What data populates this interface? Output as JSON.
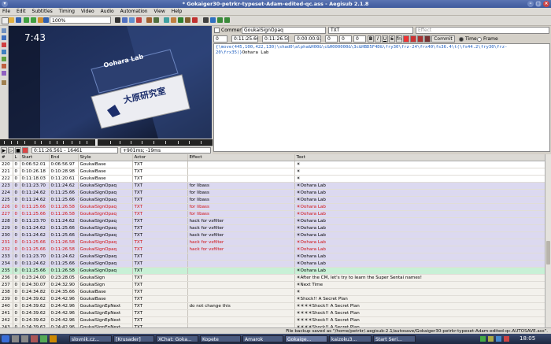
{
  "window": {
    "title": "* Gokaiger30-petrkr-typeset-Adam-edited-qc.ass - Aegisub 2.1.8"
  },
  "menu": [
    "File",
    "Edit",
    "Subtitles",
    "Timing",
    "Video",
    "Audio",
    "Automation",
    "View",
    "Help"
  ],
  "toolbar": {
    "zoom": "100%"
  },
  "video": {
    "clock": "7:43",
    "sign_en": "Oohara Lab",
    "sign_jp": "大原研究室"
  },
  "video_controls": {
    "position": "0:11:26.561 - 16461",
    "offset": "+901ms; -19ms"
  },
  "edit": {
    "comment_label": "Comment",
    "style": "GoukaiSignOpaq",
    "actor": "TXT",
    "effect_placeholder": "Effect",
    "layer": "0",
    "start": "0:11:25.66",
    "end": "0:11:26.58",
    "duration": "0:00:00.92",
    "margin_l": "0",
    "margin_r": "0",
    "margin_v": "0",
    "commit": "Commit",
    "time_label": "Time",
    "frame_label": "Frame",
    "text_tags": "{\\move(445,100,422,130)\\shad0\\alpha&H00&\\c&H000000&\\3c&HBD5F4D&\\fry30\\frz-24\\frx40\\fs36.4\\t(\\fs44.2\\fry30\\frz-20\\frx35)}",
    "text_body": "Oohara Lab"
  },
  "grid": {
    "headers": [
      "#",
      "L",
      "Start",
      "End",
      "Style",
      "Actor",
      "Effect",
      "Text"
    ],
    "rows": [
      {
        "n": "220",
        "l": "0",
        "start": "0:06:52.01",
        "end": "0:06:56.97",
        "style": "GoukaiBase",
        "actor": "TXT",
        "effect": "",
        "text": "☀",
        "kind": "comment"
      },
      {
        "n": "221",
        "l": "0",
        "start": "0:10:26.18",
        "end": "0:10:28.98",
        "style": "GoukaiBase",
        "actor": "TXT",
        "effect": "",
        "text": "☀",
        "kind": "comment"
      },
      {
        "n": "222",
        "l": "0",
        "start": "0:11:18.03",
        "end": "0:11:20.61",
        "style": "GoukaiBase",
        "actor": "TXT",
        "effect": "",
        "text": "☀",
        "kind": "comment"
      },
      {
        "n": "223",
        "l": "0",
        "start": "0:11:23.70",
        "end": "0:11:24.62",
        "style": "GoukaiSignOpaq",
        "actor": "TXT",
        "effect": "for libass",
        "text": "☀Oohara Lab",
        "kind": "sign"
      },
      {
        "n": "224",
        "l": "0",
        "start": "0:11:24.62",
        "end": "0:11:25.66",
        "style": "GoukaiSignOpaq",
        "actor": "TXT",
        "effect": "for libass",
        "text": "☀Oohara Lab",
        "kind": "sign"
      },
      {
        "n": "225",
        "l": "0",
        "start": "0:11:24.62",
        "end": "0:11:25.66",
        "style": "GoukaiSignOpaq",
        "actor": "TXT",
        "effect": "for libass",
        "text": "☀Oohara Lab",
        "kind": "sign"
      },
      {
        "n": "226",
        "l": "0",
        "start": "0:11:25.66",
        "end": "0:11:26.58",
        "style": "GoukaiSignOpaq",
        "actor": "TXT",
        "effect": "for libass",
        "text": "☀Oohara Lab",
        "kind": "red"
      },
      {
        "n": "227",
        "l": "0",
        "start": "0:11:25.66",
        "end": "0:11:26.58",
        "style": "GoukaiSignOpaq",
        "actor": "TXT",
        "effect": "for libass",
        "text": "☀Oohara Lab",
        "kind": "red"
      },
      {
        "n": "228",
        "l": "0",
        "start": "0:11:23.70",
        "end": "0:11:24.62",
        "style": "GoukaiSignOpaq",
        "actor": "TXT",
        "effect": "hack for vsfilter",
        "text": "☀Oohara Lab",
        "kind": "sign"
      },
      {
        "n": "229",
        "l": "0",
        "start": "0:11:24.62",
        "end": "0:11:25.66",
        "style": "GoukaiSignOpaq",
        "actor": "TXT",
        "effect": "hack for vsfilter",
        "text": "☀Oohara Lab",
        "kind": "sign"
      },
      {
        "n": "230",
        "l": "0",
        "start": "0:11:24.62",
        "end": "0:11:25.66",
        "style": "GoukaiSignOpaq",
        "actor": "TXT",
        "effect": "hack for vsfilter",
        "text": "☀Oohara Lab",
        "kind": "sign"
      },
      {
        "n": "231",
        "l": "0",
        "start": "0:11:25.66",
        "end": "0:11:26.58",
        "style": "GoukaiSignOpaq",
        "actor": "TXT",
        "effect": "hack for vsfilter",
        "text": "☀Oohara Lab",
        "kind": "red"
      },
      {
        "n": "232",
        "l": "0",
        "start": "0:11:25.66",
        "end": "0:11:26.58",
        "style": "GoukaiSignOpaq",
        "actor": "TXT",
        "effect": "hack for vsfilter",
        "text": "☀Oohara Lab",
        "kind": "red"
      },
      {
        "n": "233",
        "l": "0",
        "start": "0:11:23.70",
        "end": "0:11:24.62",
        "style": "GoukaiSignOpaq",
        "actor": "TXT",
        "effect": "",
        "text": "☀Oohara Lab",
        "kind": "sign"
      },
      {
        "n": "234",
        "l": "0",
        "start": "0:11:24.62",
        "end": "0:11:25.66",
        "style": "GoukaiSignOpaq",
        "actor": "TXT",
        "effect": "",
        "text": "☀Oohara Lab",
        "kind": "sign"
      },
      {
        "n": "235",
        "l": "0",
        "start": "0:11:25.66",
        "end": "0:11:26.58",
        "style": "GoukaiSignOpaq",
        "actor": "TXT",
        "effect": "",
        "text": "☀Oohara Lab",
        "kind": "cur"
      },
      {
        "n": "236",
        "l": "0",
        "start": "0:23:24.00",
        "end": "0:23:28.05",
        "style": "GoukaiSign",
        "actor": "TXT",
        "effect": "",
        "text": "☀After the CM, let's try to learn the Super Sentai names!",
        "kind": "shade"
      },
      {
        "n": "237",
        "l": "0",
        "start": "0:24:30.07",
        "end": "0:24:32.90",
        "style": "GoukaiSign",
        "actor": "TXT",
        "effect": "",
        "text": "☀Next Time",
        "kind": "shade"
      },
      {
        "n": "238",
        "l": "0",
        "start": "0:24:34.82",
        "end": "0:24:35.66",
        "style": "GoukaiBase",
        "actor": "TXT",
        "effect": "",
        "text": "☀",
        "kind": "shade"
      },
      {
        "n": "239",
        "l": "0",
        "start": "0:24:39.62",
        "end": "0:24:42.96",
        "style": "GoukaiBase",
        "actor": "TXT",
        "effect": "",
        "text": "☀Shock!! A Secret Plan",
        "kind": "shade"
      },
      {
        "n": "240",
        "l": "0",
        "start": "0:24:39.62",
        "end": "0:24:42.96",
        "style": "GoukaiSignEpNext",
        "actor": "TXT",
        "effect": "do not change this",
        "text": "☀☀☀☀Shock!! A Secret Plan",
        "kind": "shade"
      },
      {
        "n": "241",
        "l": "0",
        "start": "0:24:39.62",
        "end": "0:24:42.96",
        "style": "GoukaiSignEpNext",
        "actor": "TXT",
        "effect": "",
        "text": "☀☀☀☀Shock!! A Secret Plan",
        "kind": "shade"
      },
      {
        "n": "242",
        "l": "0",
        "start": "0:24:39.62",
        "end": "0:24:42.96",
        "style": "GoukaiSignEpNext",
        "actor": "TXT",
        "effect": "",
        "text": "☀☀☀☀Shock!! A Secret Plan",
        "kind": "shade"
      },
      {
        "n": "243",
        "l": "0",
        "start": "0:24:39.62",
        "end": "0:24:42.96",
        "style": "GoukaiSignEpNext",
        "actor": "TXT",
        "effect": "",
        "text": "☀☀☀☀Shock!! A Secret Plan",
        "kind": "shade"
      },
      {
        "n": "244",
        "l": "0",
        "start": "0:24:39.62",
        "end": "0:24:42.96",
        "style": "GoukaiSignEpNext",
        "actor": "TXT",
        "effect": "",
        "text": "☀☀☀☀Shock!! A Secret Plan",
        "kind": "shade"
      }
    ]
  },
  "status": {
    "message": "File backup saved as \"/home/petrkr/.aegisub-2.1/autosave/Gokaiger30-petrkr-typeset-Adam-edited-qc.AUTOSAVE.ass\"."
  },
  "taskbar": {
    "items": [
      "slovnik.cz...",
      "[Krusader]",
      "XChat: Goka...",
      "Kopete",
      "Amarok",
      "Gokaige...",
      "kaizoku3...",
      "Start Seri..."
    ],
    "clock": "18:05"
  }
}
